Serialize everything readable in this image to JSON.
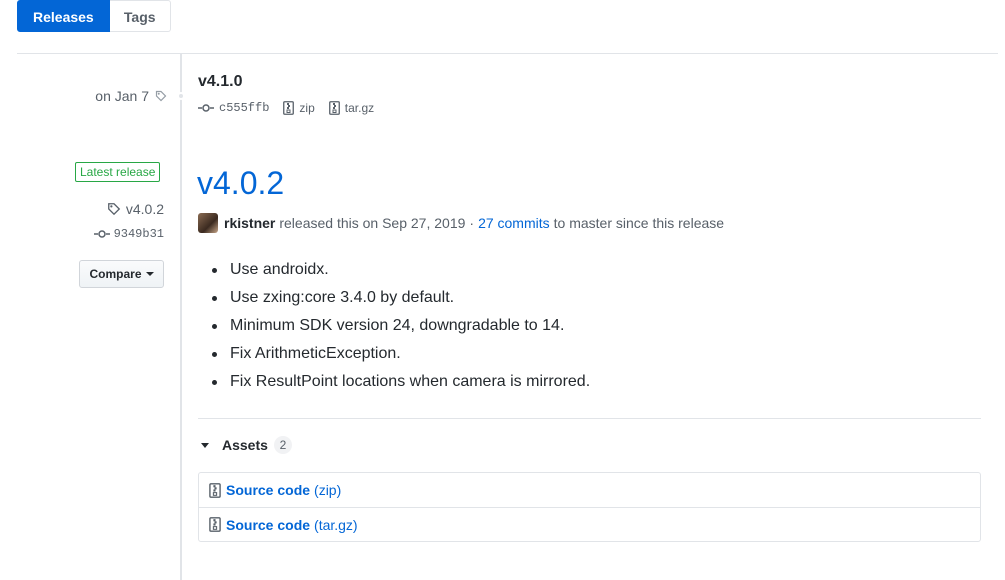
{
  "tabs": [
    {
      "label": "Releases",
      "active": true
    },
    {
      "label": "Tags",
      "active": false
    }
  ],
  "previous_release": {
    "date": "on Jan 7",
    "title": "v4.1.0",
    "commit": "c555ffb",
    "zip_label": "zip",
    "targz_label": "tar.gz"
  },
  "release": {
    "badge": "Latest release",
    "tag": "v4.0.2",
    "commit": "9349b31",
    "compare_label": "Compare",
    "title": "v4.0.2",
    "author": "rkistner",
    "released_text": "released this on Sep 27, 2019",
    "separator": "·",
    "commits_link": "27 commits",
    "commits_suffix": "to master since this release",
    "notes": [
      "Use androidx.",
      "Use zxing:core 3.4.0 by default.",
      "Minimum SDK version 24, downgradable to 14.",
      "Fix ArithmeticException.",
      "Fix ResultPoint locations when camera is mirrored."
    ],
    "assets_label": "Assets",
    "assets_count": "2",
    "assets": [
      {
        "name": "Source code",
        "ext": "(zip)"
      },
      {
        "name": "Source code",
        "ext": "(tar.gz)"
      }
    ]
  },
  "colors": {
    "accent": "#0366d6",
    "success": "#28a745",
    "muted": "#586069"
  }
}
